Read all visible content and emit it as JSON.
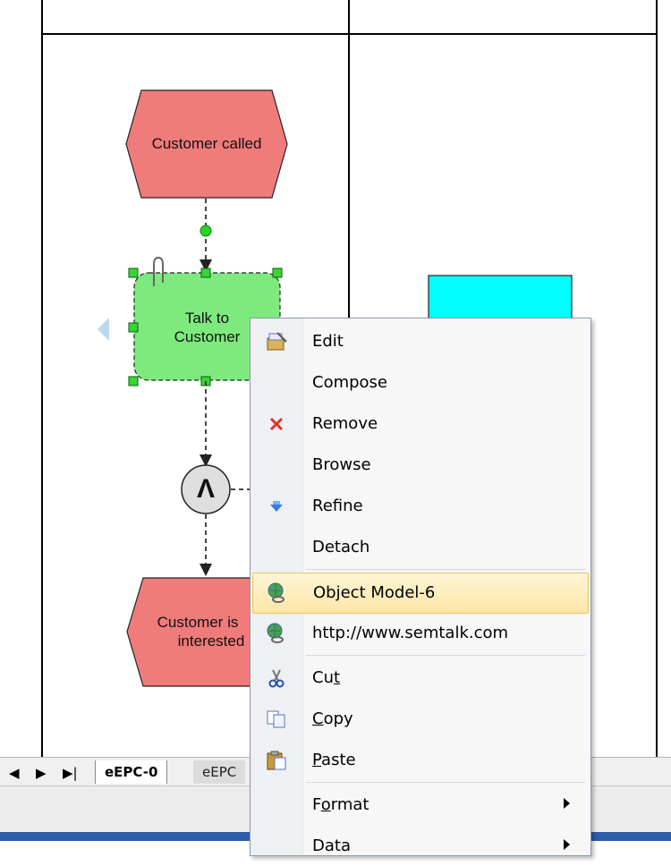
{
  "diagram": {
    "nodes": {
      "customer_called": "Customer called",
      "talk_to_customer": [
        "Talk to",
        "Customer"
      ],
      "customer_interested": [
        "Customer is",
        "interested"
      ],
      "and_gateway": "Λ"
    }
  },
  "tabs": {
    "nav": [
      "◀",
      "▶",
      "▶|"
    ],
    "items": [
      "eEPC-0",
      "eEPC"
    ]
  },
  "context_menu": {
    "items": [
      {
        "label": "Edit",
        "icon": "edit-icon"
      },
      {
        "label": "Compose",
        "icon": ""
      },
      {
        "label": "Remove",
        "icon": "remove-x-icon"
      },
      {
        "label": "Browse",
        "icon": ""
      },
      {
        "label": "Refine",
        "icon": "refine-arrow-icon"
      },
      {
        "label": "Detach",
        "icon": ""
      },
      {
        "label": "Object Model-6",
        "icon": "globe-link-icon",
        "highlighted": true
      },
      {
        "label": "http://www.semtalk.com",
        "icon": "globe-link-icon"
      },
      {
        "label": "Cut",
        "icon": "scissors-icon",
        "accelerator": "t"
      },
      {
        "label": "Copy",
        "icon": "copy-icon",
        "accelerator": "C"
      },
      {
        "label": "Paste",
        "icon": "paste-icon",
        "accelerator": "P"
      },
      {
        "label": "Format",
        "icon": "",
        "accelerator": "o",
        "submenu": true
      },
      {
        "label": "Data",
        "icon": "",
        "submenu": true
      }
    ]
  },
  "colors": {
    "event_fill": "#f07b7b",
    "function_fill": "#7eea7e",
    "aqua_box": "#00ffff",
    "menu_highlight": "#fde6a6"
  }
}
